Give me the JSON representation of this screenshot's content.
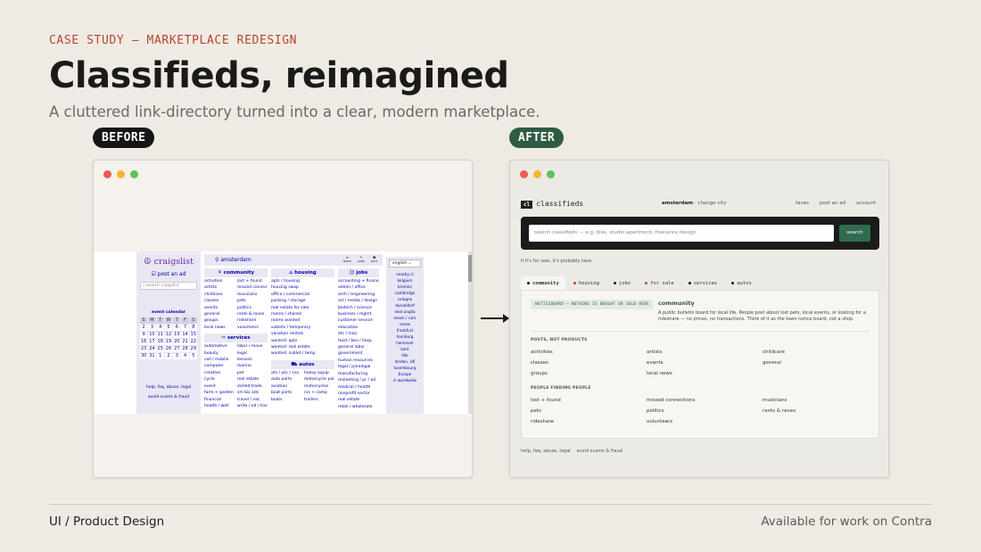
{
  "header": {
    "eyebrow": "CASE STUDY — MARKETPLACE REDESIGN",
    "title": "Classifieds, reimagined",
    "subtitle": "A cluttered link-directory turned into a clear, modern marketplace."
  },
  "labels": {
    "before": "BEFORE",
    "after": "AFTER"
  },
  "colors": {
    "accent_red": "#b5452e",
    "accent_green": "#2f5b43",
    "background": "#efebe4"
  },
  "before": {
    "logo": "craigslist",
    "post_ad": "post an ad",
    "search_placeholder": "search craigslist",
    "city": "amsterdam",
    "calendar_title": "event calendar",
    "calendar_headers": [
      "S",
      "M",
      "T",
      "W",
      "T",
      "F",
      "S"
    ],
    "calendar_days": [
      "2",
      "3",
      "4",
      "5",
      "6",
      "7",
      "8",
      "9",
      "10",
      "11",
      "12",
      "13",
      "14",
      "15",
      "16",
      "17",
      "18",
      "19",
      "20",
      "21",
      "22",
      "23",
      "24",
      "25",
      "26",
      "27",
      "28",
      "29",
      "30",
      "31",
      "1",
      "2",
      "3",
      "4",
      "5"
    ],
    "footer_links": [
      "help, faq, abuse, legal",
      "avoid scams & fraud"
    ],
    "icons": [
      {
        "name": "faves",
        "icon": "star-icon"
      },
      {
        "name": "post",
        "icon": "pen-icon"
      },
      {
        "name": "acct",
        "icon": "person-icon"
      }
    ],
    "language": "english",
    "community": {
      "title": "community",
      "items": [
        "activities",
        "lost + found",
        "artists",
        "missed connections",
        "childcare",
        "musicians",
        "classes",
        "pets",
        "events",
        "politics",
        "general",
        "rants & raves",
        "groups",
        "rideshare",
        "local news",
        "volunteers"
      ]
    },
    "services": {
      "title": "services",
      "items": [
        "automotive",
        "labor / move",
        "beauty",
        "legal",
        "cell / mobile",
        "lessons",
        "computer",
        "marine",
        "creative",
        "pet",
        "cycle",
        "real estate",
        "event",
        "skilled trade",
        "farm + garden",
        "sm biz ads",
        "financial",
        "travel / vac",
        "health / well",
        "write / ed / tran"
      ]
    },
    "housing": {
      "title": "housing",
      "items": [
        "apts / housing",
        "housing swap",
        "office / commercial",
        "parking / storage",
        "real estate for sale",
        "rooms / shared",
        "rooms wanted",
        "sublets / temporary",
        "vacation rentals",
        "wanted: apts",
        "wanted: real estate",
        "wanted: sublet / temp"
      ]
    },
    "autos": {
      "title": "autos",
      "items": [
        "atv / utv / sno",
        "heavy equip",
        "auto parts",
        "motorcycle parts",
        "aviation",
        "motorcycles",
        "boat parts",
        "rvs + camp",
        "boats",
        "trailers"
      ]
    },
    "jobs": {
      "title": "jobs",
      "items": [
        "accounting + finance",
        "admin / office",
        "arch / engineering",
        "art / media / design",
        "biotech / science",
        "business / mgmt",
        "customer service",
        "education",
        "etc / misc",
        "food / bev / hosp",
        "general labor",
        "government",
        "human resources",
        "legal / paralegal",
        "manufacturing",
        "marketing / pr / ad",
        "medical / health",
        "nonprofit sector",
        "real estate",
        "retail / wholesale"
      ]
    },
    "nearby": [
      "nearby cl",
      "belgium",
      "bremen",
      "cambridge",
      "cologne",
      "dusseldorf",
      "east anglia",
      "essen / ruhr",
      "essex",
      "frankfurt",
      "hamburg",
      "hannover",
      "kent",
      "lille",
      "london, UK",
      "luxembourg",
      "Europe",
      "cl worldwide"
    ]
  },
  "after": {
    "logo_mark": "cl",
    "logo_text": "classifieds",
    "city": "amsterdam",
    "change_city": "· change city",
    "nav": [
      "faves",
      "post an ad",
      "account"
    ],
    "search_placeholder": "search classifieds — e.g. bike, studio apartment, freelance design",
    "search_button": "search",
    "tagline": "If it's for sale, it's probably here",
    "tabs": [
      {
        "label": "community",
        "color": "#1b1b1b"
      },
      {
        "label": "housing",
        "color": "#c0442e"
      },
      {
        "label": "jobs",
        "color": "#1b1b1b"
      },
      {
        "label": "for sale",
        "color": "#c0442e"
      },
      {
        "label": "services",
        "color": "#1b1b1b"
      },
      {
        "label": "autos",
        "color": "#1b1b1b"
      }
    ],
    "notice": "NOTICEBOARD — NOTHING IS BOUGHT OR SOLD HERE",
    "category_title": "community",
    "category_desc": "A public bulletin board for local life. People post about lost pets, local events, or looking for a rideshare — no prices, no transactions. Think of it as the town notice board, not a shop.",
    "section1_title": "POSTS, NOT PRODUCTS",
    "section1_links": [
      "activities",
      "artists",
      "childcare",
      "classes",
      "events",
      "general",
      "groups",
      "local news"
    ],
    "section2_title": "PEOPLE FINDING PEOPLE",
    "section2_links": [
      "lost + found",
      "missed connections",
      "musicians",
      "pets",
      "politics",
      "rants & raves",
      "rideshare",
      "volunteers"
    ],
    "footer_links": [
      "help, faq, abuse, legal",
      "avoid scams & fraud"
    ]
  },
  "footer": {
    "left": "UI / Product Design",
    "right": "Available for work on Contra"
  }
}
